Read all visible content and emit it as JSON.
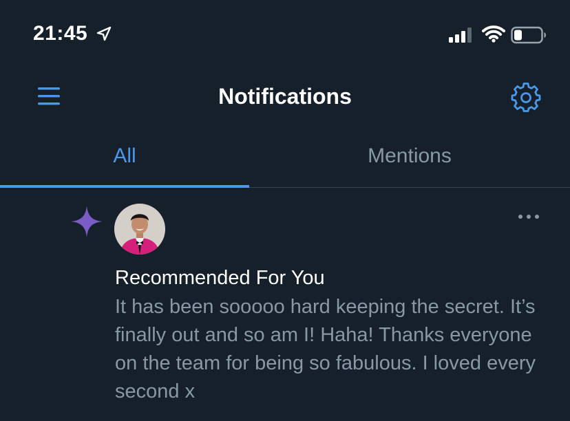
{
  "status_bar": {
    "time": "21:45",
    "icons": [
      "location-arrow-icon",
      "cellular-signal-icon",
      "wifi-icon",
      "battery-icon"
    ]
  },
  "header": {
    "title": "Notifications",
    "menu_icon": "hamburger-menu-icon",
    "settings_icon": "gear-icon"
  },
  "tabs": [
    {
      "label": "All",
      "active": true
    },
    {
      "label": "Mentions",
      "active": false
    }
  ],
  "notification": {
    "type_icon": "sparkle-icon",
    "title": "Recommended For You",
    "body": "It has been sooooo hard keeping the secret. It’s finally out and so am I! Haha! Thanks everyone on the team for being so fabulous. I loved every second x",
    "more_icon": "more-options-icon"
  },
  "colors": {
    "background": "#15202b",
    "accent": "#4a99e9",
    "secondary_text": "#8899a6",
    "sparkle": "#7b5cc6",
    "divider": "#38444d"
  }
}
